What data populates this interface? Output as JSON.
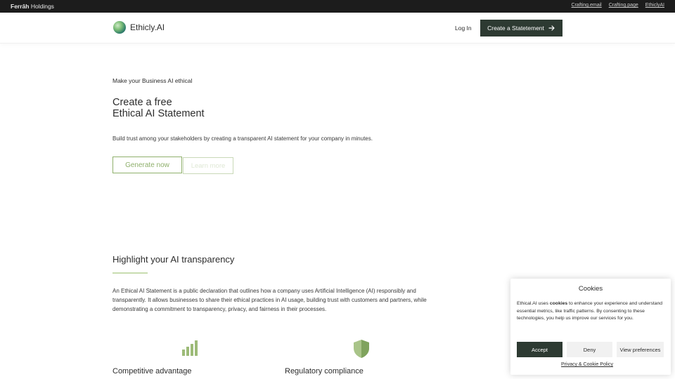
{
  "topbar": {
    "brand_bold": "Ferrāh",
    "brand_rest": "Holdings",
    "links": [
      "Crafting.email",
      "Crafting.page",
      "EthiclyAI"
    ]
  },
  "nav": {
    "logo_text": "Ethicly.AI",
    "login": "Log In",
    "cta": "Create a Statetement",
    "cta_icon": "arrow-right-icon"
  },
  "hero": {
    "eyebrow": "Make your Business AI ethical",
    "title_line1": "Create a free",
    "title_line2": "Ethical AI Statement",
    "description": "Build trust among your stakeholders by creating a transparent AI statement for your company in minutes.",
    "primary_button": "Generate now",
    "secondary_button": "Learn more"
  },
  "transparency": {
    "title": "Highlight your AI transparency",
    "body": "An Ethical AI Statement is a public declaration that outlines how a company uses Artificial Intelligence (AI) responsibly and transparently. It allows businesses to share their ethical practices in AI usage, building trust with customers and partners, while demonstrating a commitment to transparency, privacy, and fairness in their processes.",
    "features": [
      {
        "label": "Competitive advantage",
        "icon": "bar-chart-icon"
      },
      {
        "label": "Regulatory compliance",
        "icon": "shield-icon"
      }
    ]
  },
  "cookies": {
    "title": "Cookies",
    "text_before": "Ethical.AI uses ",
    "text_bold": "cookies",
    "text_after": " to enhance your experience and understand essential metrics, like traffic patterns. By consenting to these technologies, you help us improve our services for you.",
    "accept": "Accept",
    "deny": "Deny",
    "preferences": "View preferences",
    "policy_link": "Privacy & Cookie Policy"
  },
  "colors": {
    "dark_green": "#2d3a32",
    "accent_green": "#8fb06c",
    "light_green": "#c8dcb0",
    "topbar": "#1c1c1c"
  }
}
